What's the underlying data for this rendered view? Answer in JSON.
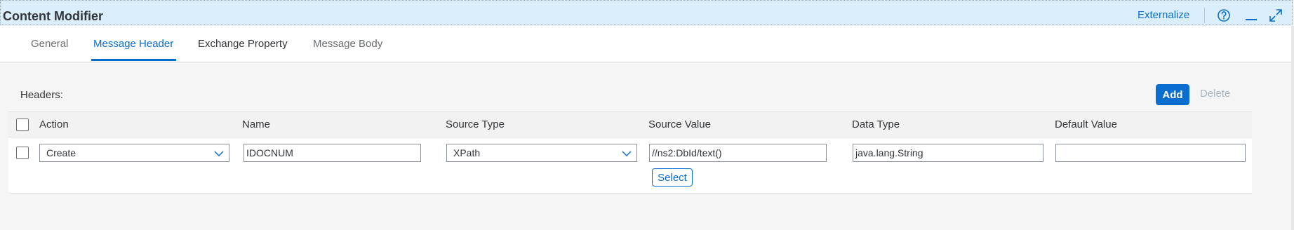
{
  "header": {
    "title": "Content Modifier",
    "externalize_label": "Externalize",
    "icons": {
      "help": "help-icon",
      "minimize": "minimize-icon",
      "maximize": "maximize-icon"
    }
  },
  "tabs": [
    {
      "label": "General",
      "selected": false
    },
    {
      "label": "Message Header",
      "selected": true
    },
    {
      "label": "Exchange Property",
      "selected": false
    },
    {
      "label": "Message Body",
      "selected": false
    }
  ],
  "headers_section": {
    "label": "Headers:",
    "add_label": "Add",
    "delete_label": "Delete"
  },
  "table": {
    "columns": [
      "Action",
      "Name",
      "Source Type",
      "Source Value",
      "Data Type",
      "Default Value"
    ],
    "rows": [
      {
        "checked": false,
        "action": "Create",
        "name": "IDOCNUM",
        "source_type": "XPath",
        "source_value": "//ns2:DbId/text()",
        "select_label": "Select",
        "data_type": "java.lang.String",
        "default_value": ""
      }
    ]
  },
  "colors": {
    "accent": "#0a6ed1",
    "header_bg": "#dbeefb",
    "disabled_text": "#a9b4be"
  }
}
